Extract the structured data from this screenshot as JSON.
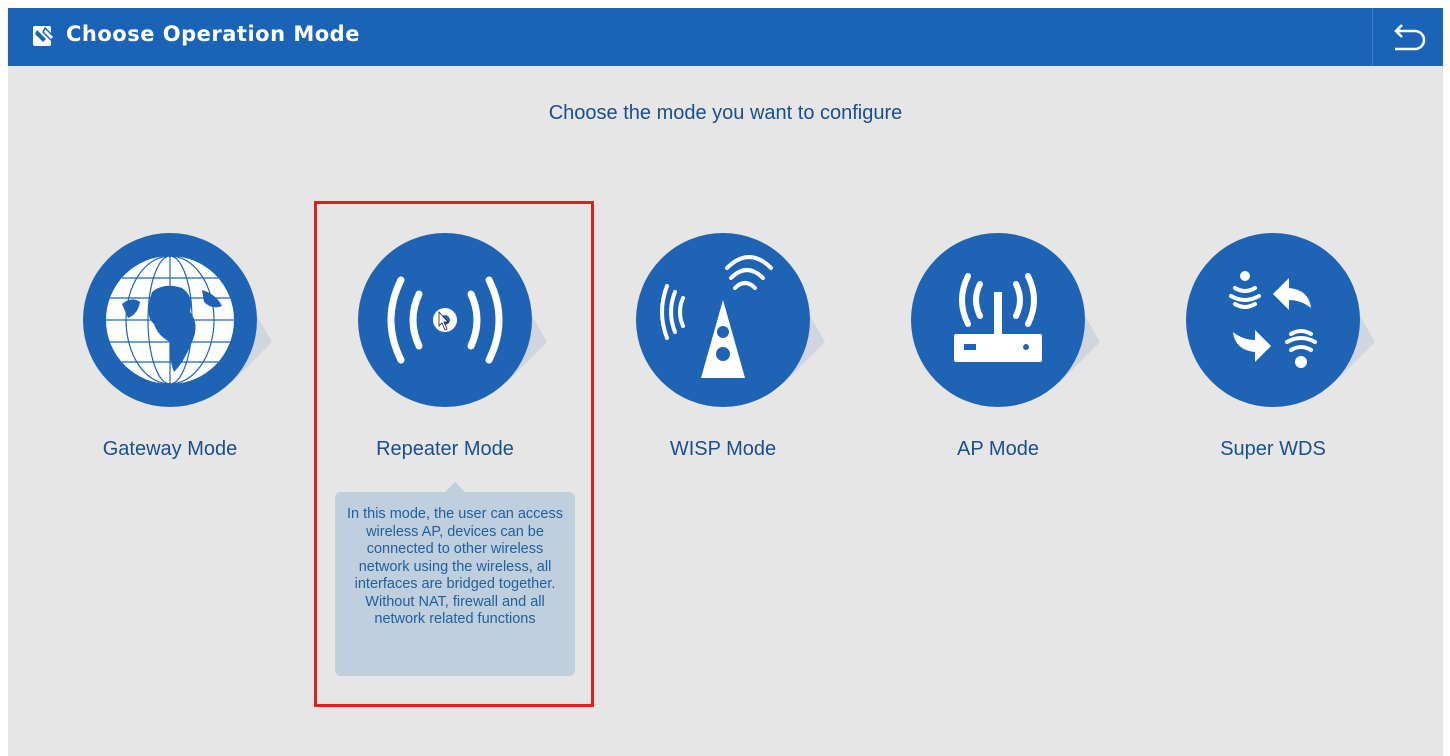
{
  "header": {
    "title": "Choose Operation Mode",
    "app_icon": "router-setup-icon",
    "back_icon": "back-arrow-icon"
  },
  "subtitle": "Choose the mode you want to configure",
  "modes": [
    {
      "label": "Gateway Mode",
      "icon": "globe-icon"
    },
    {
      "label": "Repeater Mode",
      "icon": "wireless-signal-icon"
    },
    {
      "label": "WISP Mode",
      "icon": "tower-icon"
    },
    {
      "label": "AP Mode",
      "icon": "router-icon"
    },
    {
      "label": "Super WDS",
      "icon": "wds-exchange-icon"
    }
  ],
  "tooltip": {
    "text": "In this mode, the user can access wireless AP, devices can be connected to other wireless network using the wireless, all interfaces are bridged together. Without NAT, firewall and all network related functions"
  },
  "colors": {
    "header_bg": "#1b63b7",
    "circle": "#1f63b5",
    "page_bg": "#e6e6e6",
    "text": "#1a4f8a",
    "highlight": "#e02020",
    "tooltip_bg": "#bfcfdd"
  }
}
